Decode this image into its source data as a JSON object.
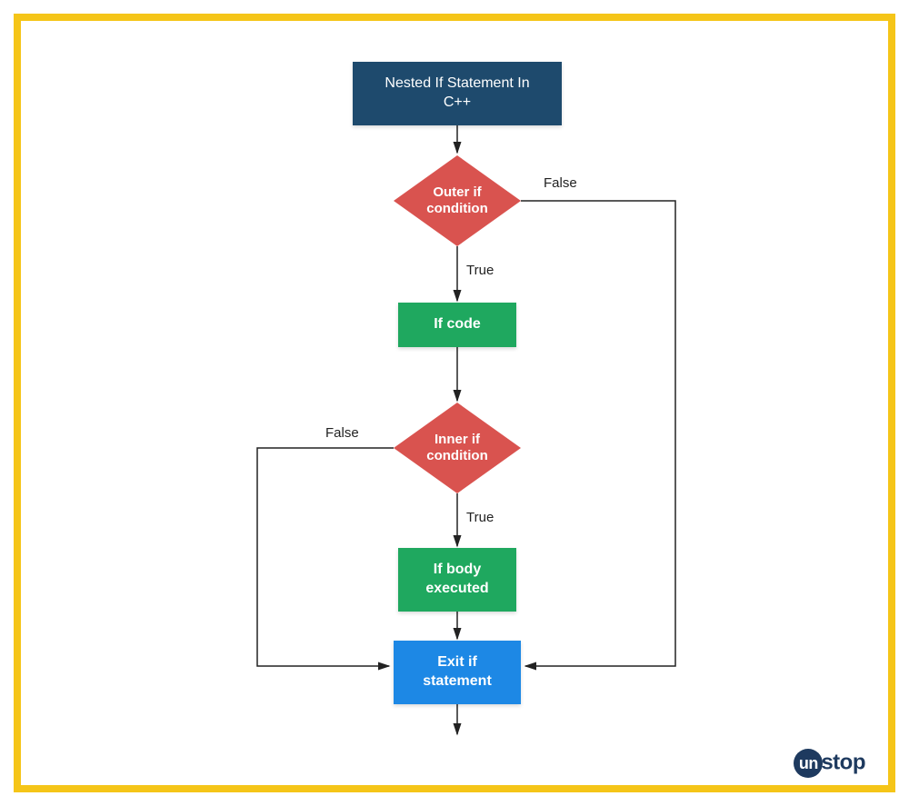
{
  "title": "Nested If Statement In C++",
  "nodes": {
    "outer_if": "Outer if\ncondition",
    "if_code": "If code",
    "inner_if": "Inner if\ncondition",
    "if_body": "If body\nexecuted",
    "exit": "Exit if\nstatement"
  },
  "labels": {
    "true1": "True",
    "false1": "False",
    "true2": "True",
    "false2": "False"
  },
  "logo": {
    "prefix": "un",
    "suffix": "stop"
  },
  "colors": {
    "frame": "#f5c518",
    "title_bg": "#1e4a6d",
    "diamond_bg": "#d9534f",
    "green_bg": "#1fa85f",
    "blue_bg": "#1d88e5"
  }
}
